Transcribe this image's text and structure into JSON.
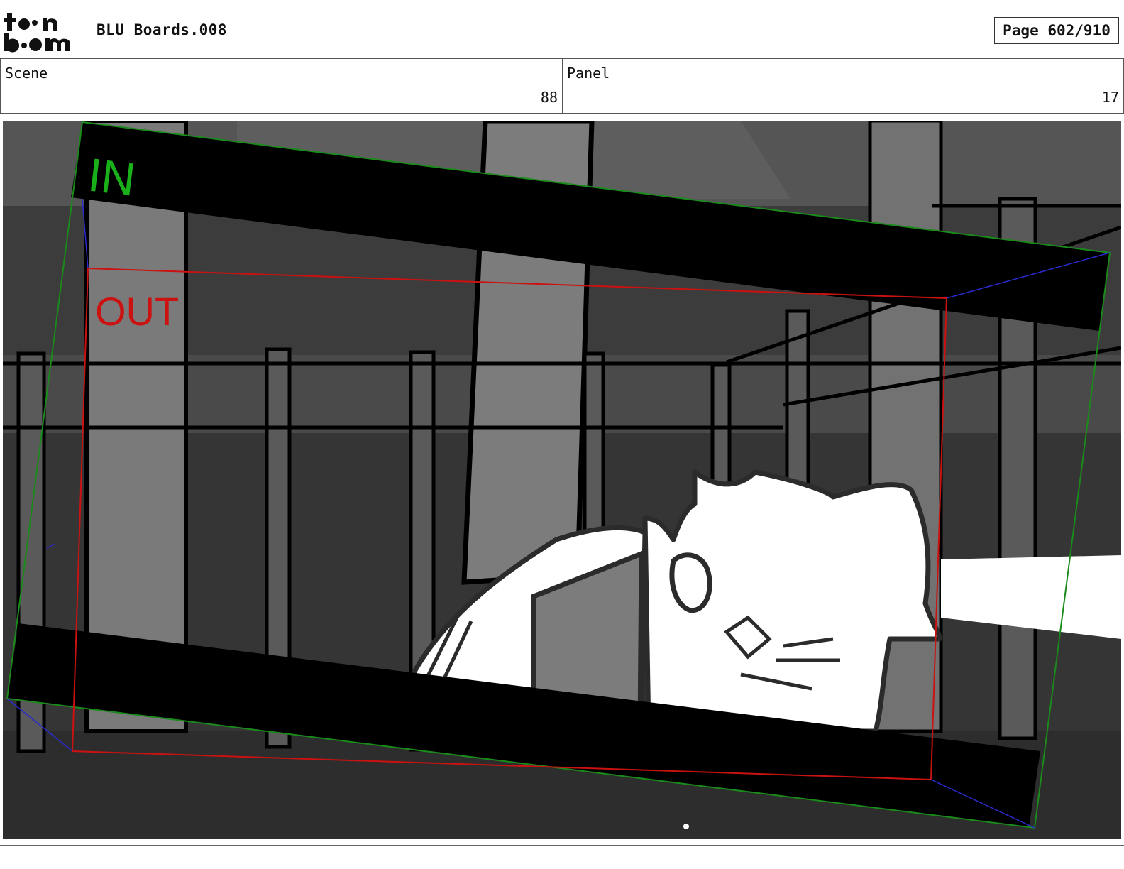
{
  "header": {
    "logo_text": "toon boom",
    "doc_title": "BLU Boards.008",
    "page_label": "Page 602/910"
  },
  "scene": {
    "label": "Scene",
    "value": "88"
  },
  "panel": {
    "label": "Panel",
    "value": "17"
  },
  "frame_labels": {
    "in": "IN",
    "out": "OUT"
  },
  "colors": {
    "in_frame": "#1a8a1a",
    "out_frame": "#cc1111",
    "camera_path": "#2a2ad0"
  }
}
